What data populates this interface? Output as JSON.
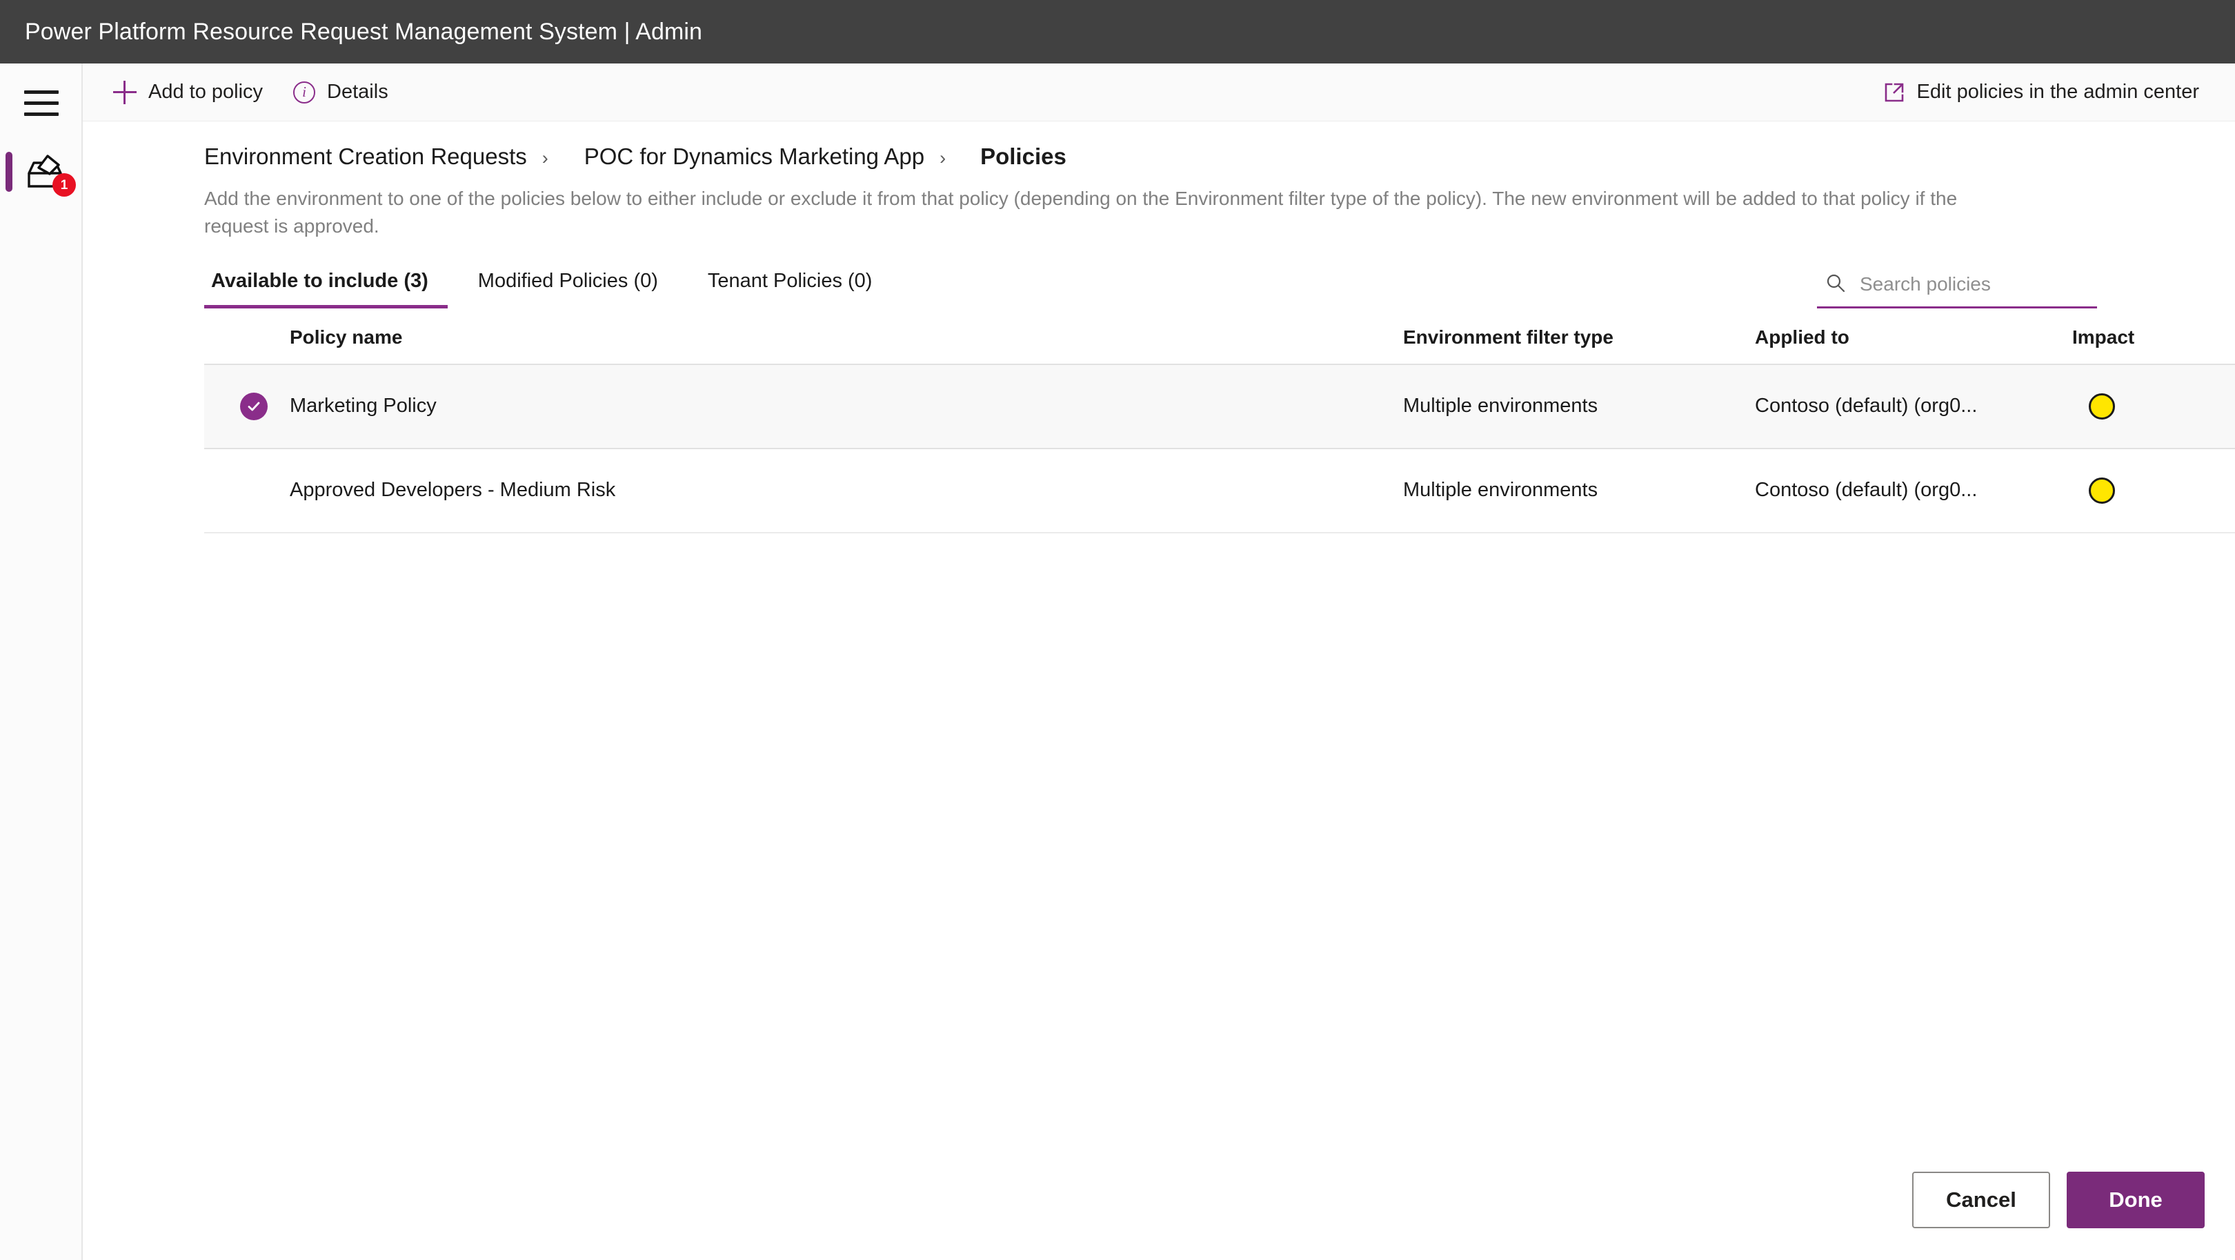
{
  "titlebar": {
    "title": "Power Platform Resource Request Management System | Admin"
  },
  "rail": {
    "menu_icon": "hamburger-menu-icon",
    "item": {
      "icon": "inbox-tray-icon",
      "badge": "1"
    }
  },
  "commandbar": {
    "add_to_policy": "Add to policy",
    "add_icon": "plus-icon",
    "details": "Details",
    "details_icon": "info-icon",
    "edit_policies": "Edit policies in the admin center",
    "edit_icon": "open-in-new-window-icon"
  },
  "breadcrumb": {
    "items": [
      {
        "label": "Environment Creation Requests",
        "current": false
      },
      {
        "label": "POC for Dynamics Marketing App",
        "current": false
      },
      {
        "label": "Policies",
        "current": true
      }
    ],
    "separator": "›"
  },
  "description": "Add the environment to one of the policies below to either include or exclude it from that policy (depending on the Environment filter type of the policy). The new environment will be added to that policy if the request is approved.",
  "tabs": [
    {
      "label": "Available to include (3)",
      "active": true
    },
    {
      "label": "Modified Policies (0)",
      "active": false
    },
    {
      "label": "Tenant Policies (0)",
      "active": false
    }
  ],
  "search": {
    "placeholder": "Search policies",
    "value": "",
    "icon": "search-icon"
  },
  "table": {
    "headers": {
      "check": "",
      "name": "Policy name",
      "env": "Environment filter type",
      "applied": "Applied to",
      "impact": "Impact"
    },
    "rows": [
      {
        "selected": true,
        "name": "Marketing Policy",
        "env": "Multiple environments",
        "applied": "Contoso (default) (org0...",
        "impact_color": "#FFE600",
        "impact_label": "medium-impact"
      },
      {
        "selected": false,
        "name": "Approved Developers - Medium Risk",
        "env": "Multiple environments",
        "applied": "Contoso (default) (org0...",
        "impact_color": "#FFE600",
        "impact_label": "medium-impact"
      }
    ]
  },
  "footer": {
    "cancel": "Cancel",
    "done": "Done"
  },
  "colors": {
    "accent_purple": "#8a2d8a",
    "done_purple": "#7a2b7a",
    "titlebar": "#414141",
    "badge_red": "#e81123",
    "impact_yellow": "#FFE600"
  }
}
